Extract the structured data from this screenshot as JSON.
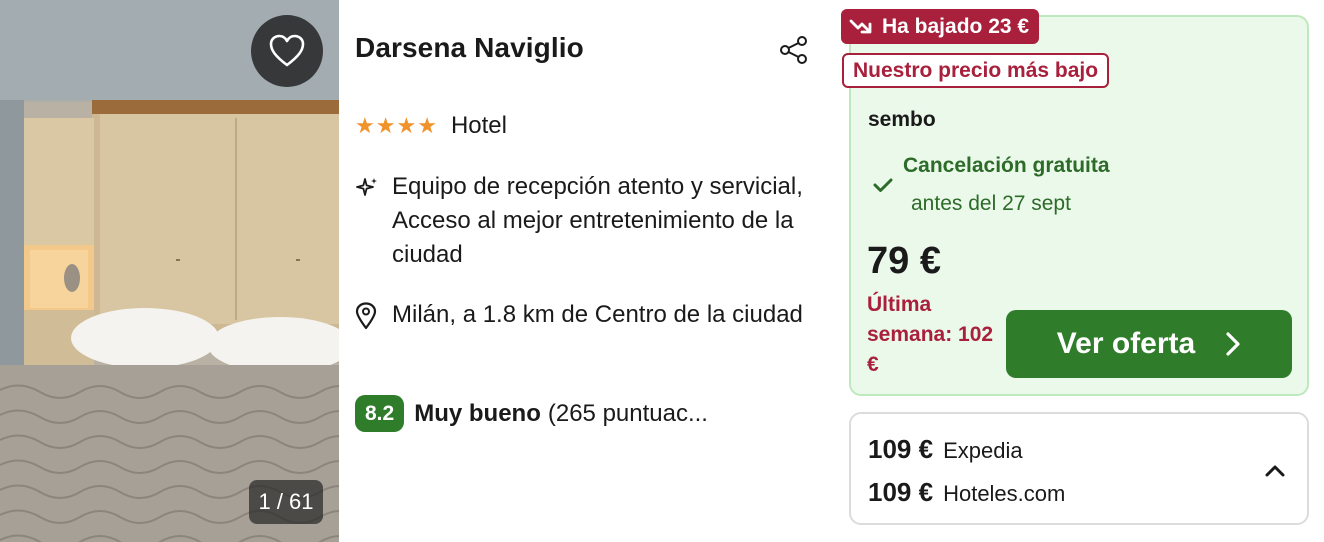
{
  "photo": {
    "counter": "1 / 61",
    "favorite_icon": "heart-icon"
  },
  "hotel": {
    "name": "Darsena Naviglio",
    "stars": 4,
    "type": "Hotel",
    "features_icon": "sparkle-icon",
    "features": "Equipo de recepción atento y servicial, Acceso al mejor entretenimiento de la ciudad",
    "location_icon": "map-pin-icon",
    "location": "Milán, a 1.8 km de Centro de la ciudad",
    "review": {
      "score": "8.2",
      "label": "Muy bueno",
      "count": "(265 puntuac..."
    }
  },
  "deal": {
    "drop_badge": "Ha bajado 23 €",
    "lowest_badge": "Nuestro precio más bajo",
    "provider": "sembo",
    "cancellation_title": "Cancelación gratuita",
    "cancellation_sub": "antes del 27 sept",
    "price": "79 €",
    "last_week": "Última semana: 102 €",
    "cta_label": "Ver oferta"
  },
  "other_offers": [
    {
      "price": "109 €",
      "site": "Expedia"
    },
    {
      "price": "109 €",
      "site": "Hoteles.com"
    }
  ],
  "colors": {
    "accent_green": "#2f7d2a",
    "deal_background": "#ebf9eb",
    "badge_red": "#a8203b",
    "star_orange": "#f0932b"
  }
}
